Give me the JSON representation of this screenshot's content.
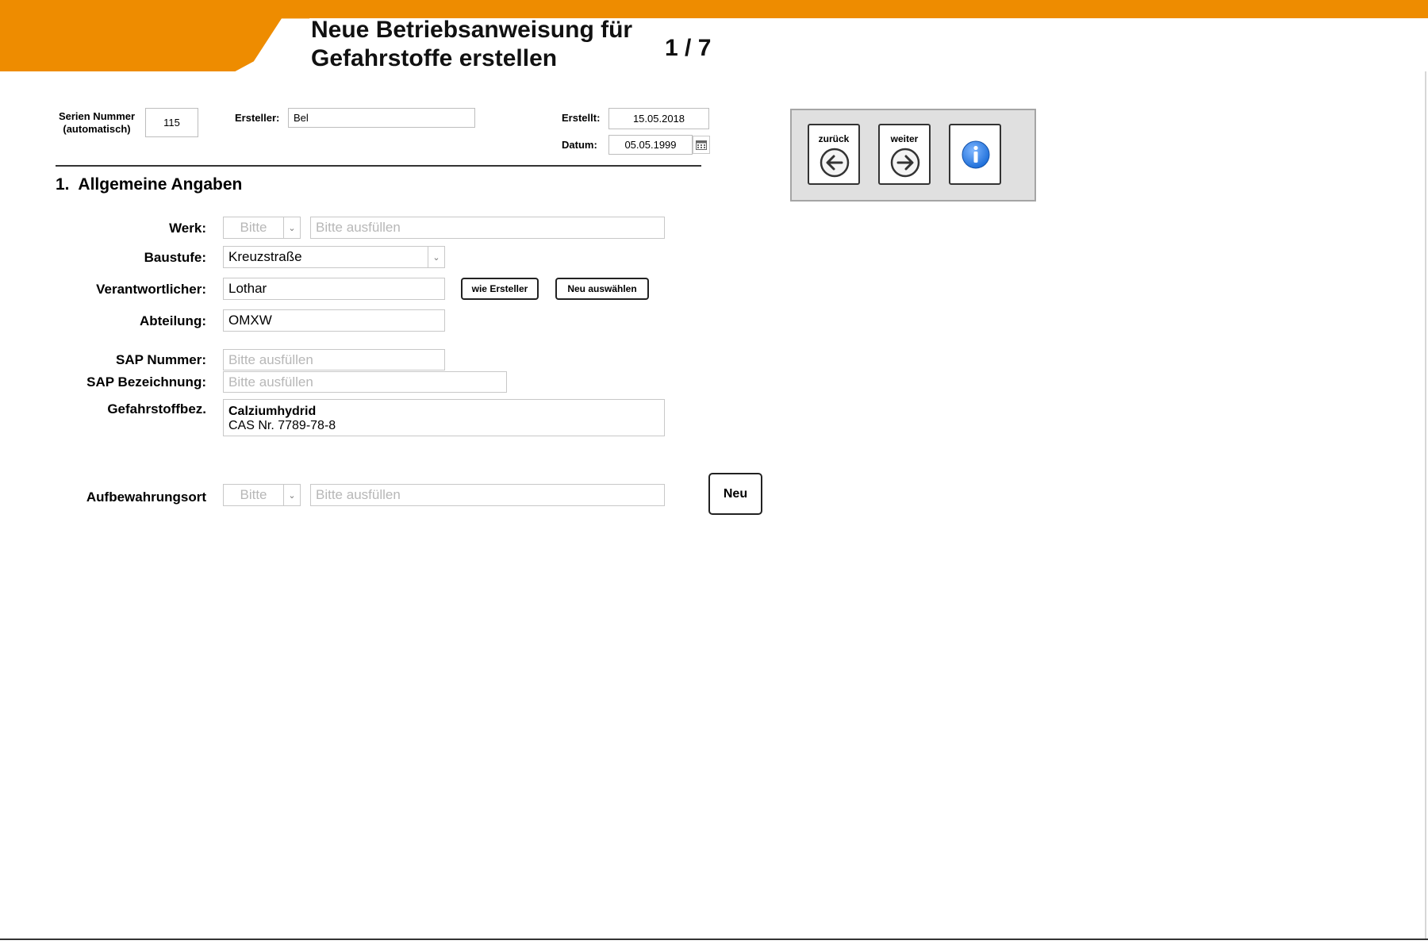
{
  "header": {
    "title_line1": "Neue Betriebsanweisung für",
    "title_line2": "Gefahrstoffe erstellen",
    "page_indicator": "1 / 7",
    "accent_color": "#EE8C00"
  },
  "meta": {
    "serial_label_line1": "Serien Nummer",
    "serial_label_line2": "(automatisch)",
    "serial_value": "115",
    "creator_label": "Ersteller:",
    "creator_value": "Bel",
    "created_label": "Erstellt:",
    "created_value": "15.05.2018",
    "date_label": "Datum:",
    "date_value": "05.05.1999",
    "calendar_icon": "calendar-icon"
  },
  "section": {
    "number": "1.",
    "title": "Allgemeine Angaben"
  },
  "form": {
    "werk_label": "Werk:",
    "werk_select": "Bitte",
    "werk_placeholder": "Bitte ausfüllen",
    "baustufe_label": "Baustufe:",
    "baustufe_value": "Kreuzstraße",
    "verantwortlicher_label": "Verantwortlicher:",
    "verantwortlicher_value": "Lothar",
    "wie_ersteller_button": "wie Ersteller",
    "neu_auswaehlen_button": "Neu auswählen",
    "abteilung_label": "Abteilung:",
    "abteilung_value": "OMXW",
    "sap_nummer_label": "SAP Nummer:",
    "sap_nummer_placeholder": "Bitte ausfüllen",
    "sap_bezeichnung_label": "SAP Bezeichnung:",
    "sap_bezeichnung_placeholder": "Bitte ausfüllen",
    "gefahrstoff_label": "Gefahrstoffbez.",
    "gefahrstoff_line1": "Calziumhydrid",
    "gefahrstoff_line2": "CAS Nr. 7789-78-8",
    "aufbewahrungsort_label": "Aufbewahrungsort",
    "aufbewahrungsort_select": "Bitte",
    "aufbewahrungsort_placeholder": "Bitte ausfüllen",
    "neu_button": "Neu"
  },
  "nav": {
    "back_label": "zurück",
    "back_icon": "arrow-left-circle-icon",
    "forward_label": "weiter",
    "forward_icon": "arrow-right-circle-icon",
    "info_icon": "info-icon",
    "info_color": "#1E6FD9"
  }
}
